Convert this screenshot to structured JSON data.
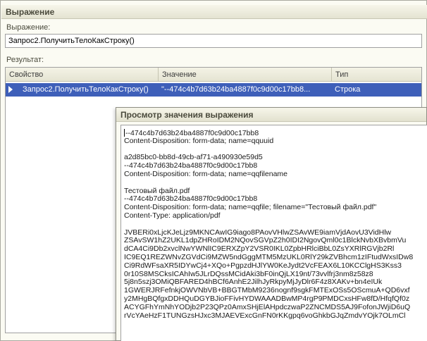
{
  "window": {
    "title": "Выражение"
  },
  "expression": {
    "label": "Выражение:",
    "value": "Запрос2.ПолучитьТелоКакСтроку()"
  },
  "result": {
    "label": "Результат:",
    "columns": [
      "Свойство",
      "Значение",
      "Тип"
    ],
    "rows": [
      {
        "property": "Запрос2.ПолучитьТелоКакСтроку()",
        "value": "\"--474c4b7d63b24ba4887f0c9d00c17bb8...",
        "type": "Строка"
      }
    ]
  },
  "popup": {
    "title": "Просмотр значения выражения",
    "lines": [
      "--474c4b7d63b24ba4887f0c9d00c17bb8",
      "Content-Disposition: form-data; name=qquuid",
      "",
      "a2d85bc0-bb8d-49cb-af71-a490930e59d5",
      "--474c4b7d63b24ba4887f0c9d00c17bb8",
      "Content-Disposition: form-data; name=qqfilename",
      "",
      "Тестовый файл.pdf",
      "--474c4b7d63b24ba4887f0c9d00c17bb8",
      "Content-Disposition: form-data; name=qqfile; filename=\"Тестовый файл.pdf\"",
      "Content-Type: application/pdf",
      "",
      "JVBERi0xLjcKJeLjz9MKNCAwIG9iago8PAovVHlwZSAvWE9iamVjdAovU3VidHlw",
      "ZSAvSW1hZ2UKL1dpZHRoIDM2NQovSGVpZ2h0IDI2NgovQml0c1BlckNvbXBvbmVu",
      "dCA4Ci9Db2xvclNwYWNlIC9ERXZpY2VSR0IKL0ZpbHRlciBbL0ZsYXRlRGVjb2Rl",
      "IC9EQ1REZWNvZGVdCi9MZW5ndGggMTM5MzUKL0RlY29kZVBhcm1zIFtudWxsIDw8",
      "Ci9RdWFsaXR5IDYwCj4+XQo+PgpzdHJlYW0KeJydt2VcFEAX6L10KCClgHS3Kss3",
      "0r10S8MSCksICAhIw5JLrDQssMCidAki3bF0inQjLX19nt/73vvlfrj3nm8z58z8",
      "5j8n5szj3OMiQBFARED4hBCf6AnhE2JilhJyRkpyMjJyDlr6F4z8XAKv+bn4eIUk",
      "1GWERJRFefnkjOWVNbVB+BBGTMbM9236nognf9sgkFMTExOSs5OScmuA+QD6vxf",
      "y2MHgBQfgxDDHQuDGYBJioFFivHYDWAAADBwMP4rgP9PMDCxsHFw8fD/HfqfQf0z",
      "ACYGFhYmNhYODjb2P23QPz0AmxSHjElAHpdczwaP2ZNCMDS5AJ9FofonJWjiD6uQ",
      "rVcYAeHzF1TUNGzsHJxc3MJAEVExcGnFN0rKKgpq6voGhkbGJqZmdvYOjk7OLmCl"
    ]
  }
}
